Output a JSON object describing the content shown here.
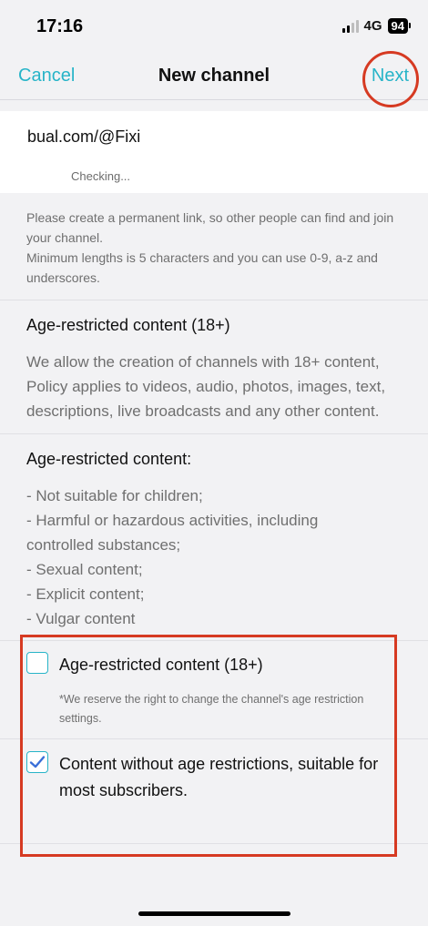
{
  "status_bar": {
    "time": "17:16",
    "network": "4G",
    "battery": "94"
  },
  "nav": {
    "cancel_label": "Cancel",
    "title": "New channel",
    "next_label": "Next"
  },
  "link": {
    "value": "bual.com/@Fixi",
    "status": "Checking..."
  },
  "help": {
    "line1": "Please create a permanent link, so other people can find and join your channel.",
    "line2": "Minimum lengths is 5 characters and you can use 0-9, a-z and underscores."
  },
  "age_section": {
    "title": "Age-restricted content (18+)",
    "body": "We allow the creation of channels with 18+ content, Policy applies to videos, audio, photos, images, text, descriptions, live broadcasts and any other content."
  },
  "content_section": {
    "title": "Age-restricted content:",
    "items": [
      "- Not suitable for children;",
      "- Harmful or hazardous activities, including controlled substances;",
      "- Sexual content;",
      "- Explicit content;",
      "- Vulgar content"
    ]
  },
  "options": [
    {
      "label": "Age-restricted content (18+)",
      "note": "*We reserve the right to change the channel's age restriction settings.",
      "checked": false
    },
    {
      "label": "Content without age restrictions, suitable for most subscribers.",
      "checked": true
    }
  ],
  "colors": {
    "accent": "#27b4c8",
    "annotation": "#d63a22",
    "background": "#f2f2f4"
  }
}
